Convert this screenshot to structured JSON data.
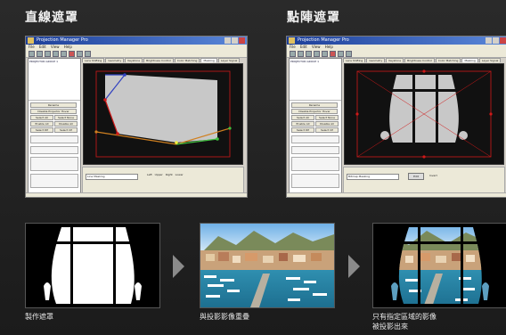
{
  "headings": {
    "left": "直線遮罩",
    "right": "點陣遮罩"
  },
  "app_window": {
    "title": "Projection Manager Pro",
    "menu": [
      "File",
      "Edit",
      "View",
      "Help"
    ],
    "tree_item": "PROJECTOR GROUP 1",
    "side_buttons": [
      "Rename",
      "Disable Projector Hover",
      "Select All",
      "Select None",
      "Enable All",
      "Disable All",
      "Select DP",
      "Select CP",
      "Select Page",
      "Next",
      "Prev"
    ],
    "tabs": [
      "Lens Shifting",
      "Geometry",
      "Keystone",
      "Brightness Control",
      "Color Matching",
      "Masking",
      "Layer Signal",
      "Video"
    ],
    "active_tab": "Masking",
    "left_panel_select": "Line Masking",
    "right_panel_select": "Bitmap Masking",
    "left_checks": [
      "Left",
      "Upper",
      "Right",
      "Lower"
    ],
    "right_button": "Edit",
    "right_check": "Invert"
  },
  "steps": [
    {
      "caption": "製作遮罩"
    },
    {
      "caption": "與投影影像重疊"
    },
    {
      "caption_line1": "只有指定區域的影像",
      "caption_line2": "被投影出來"
    }
  ],
  "colors": {
    "mask_white": "#ffffff",
    "mask_gray": "#c8c8c8",
    "guide_red": "#d01818",
    "guide_blue": "#3040c0",
    "guide_green": "#40c040",
    "guide_orange": "#d08020"
  }
}
